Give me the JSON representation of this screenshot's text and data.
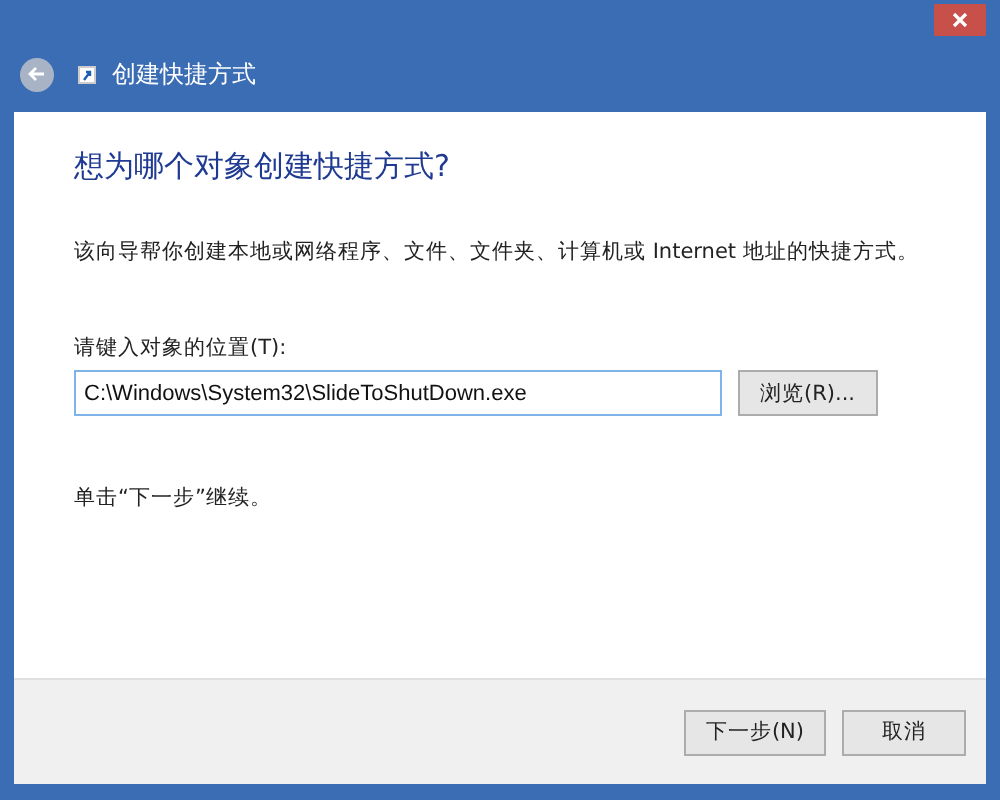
{
  "window": {
    "title": "创建快捷方式",
    "back_disabled": true
  },
  "heading": "想为哪个对象创建快捷方式?",
  "description": "该向导帮你创建本地或网络程序、文件、文件夹、计算机或 Internet 地址的快捷方式。",
  "location": {
    "label": "请键入对象的位置(T):",
    "value": "C:\\Windows\\System32\\SlideToShutDown.exe",
    "browse": "浏览(R)..."
  },
  "hint": "单击“下一步”继续。",
  "buttons": [
    "下一步(N)",
    "取消"
  ]
}
